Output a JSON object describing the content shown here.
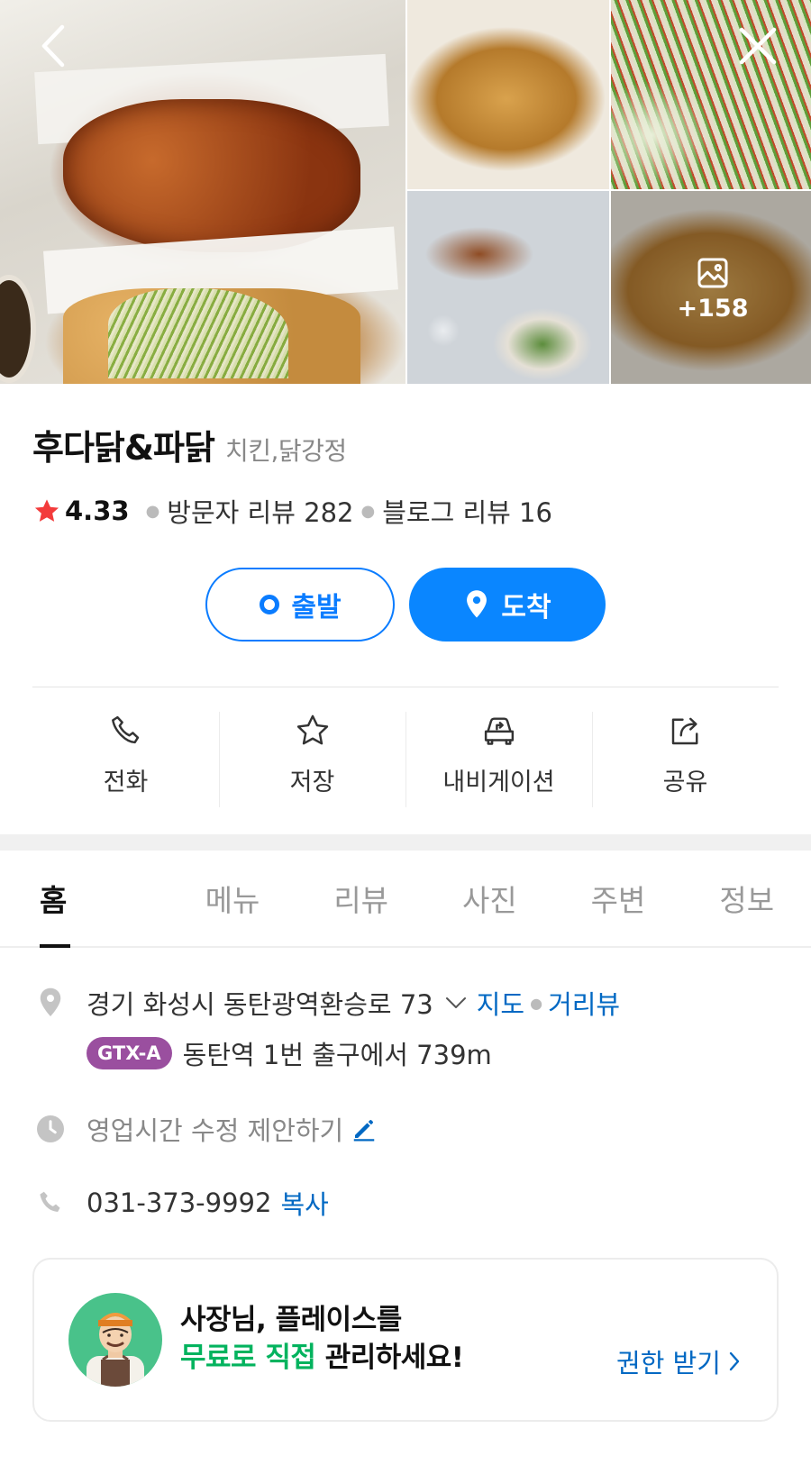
{
  "gallery": {
    "more_count": "+158"
  },
  "place": {
    "name": "후다닭&파닭",
    "category": "치킨,닭강정",
    "rating": "4.33",
    "visitor_reviews": "방문자 리뷰 282",
    "blog_reviews": "블로그 리뷰 16"
  },
  "route": {
    "start_label": "출발",
    "arrive_label": "도착"
  },
  "actions": [
    {
      "label": "전화",
      "icon": "phone-icon"
    },
    {
      "label": "저장",
      "icon": "star-icon"
    },
    {
      "label": "내비게이션",
      "icon": "car-navigation-icon"
    },
    {
      "label": "공유",
      "icon": "share-icon"
    }
  ],
  "tabs": [
    "홈",
    "메뉴",
    "리뷰",
    "사진",
    "주변",
    "정보"
  ],
  "info": {
    "address": "경기 화성시 동탄광역환승로 73",
    "map_link": "지도",
    "street_view_link": "거리뷰",
    "transit_badge": "GTX-A",
    "transit_text": "동탄역 1번 출구에서 739m",
    "hours_text": "영업시간 수정 제안하기",
    "phone": "031-373-9992",
    "copy_label": "복사"
  },
  "owner_banner": {
    "line1": "사장님, 플레이스를",
    "line2_highlight": "무료로 직접",
    "line2_rest": "관리하세요!",
    "cta": "권한 받기"
  },
  "colors": {
    "accent_blue": "#0a86ff",
    "link_blue": "#0068c3",
    "rating_star": "#f33b3b",
    "gtx_purple": "#9a4f9f",
    "banner_green": "#03b35e"
  }
}
